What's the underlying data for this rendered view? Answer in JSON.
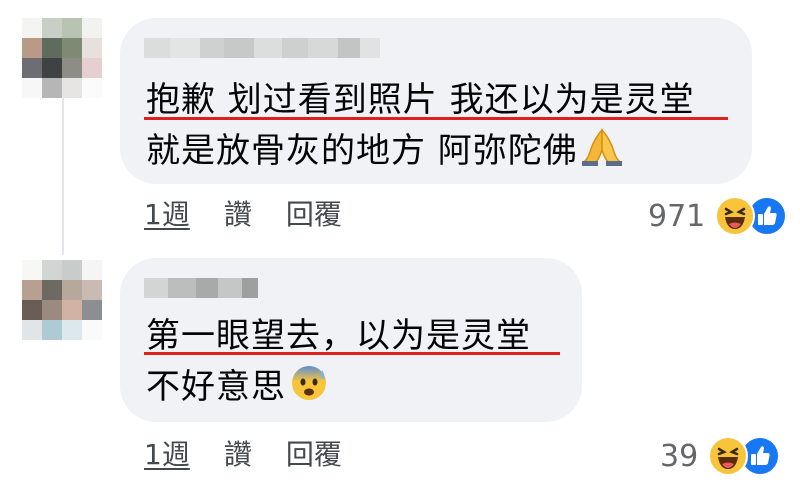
{
  "comments": [
    {
      "lines": [
        "抱歉 划过看到照片 我还以为是灵堂",
        "就是放骨灰的地方 阿弥陀佛"
      ],
      "emoji": "folded-hands-icon",
      "actions": {
        "time": "1週",
        "like": "讚",
        "reply": "回覆"
      },
      "reaction_count": "971"
    },
    {
      "lines": [
        "第一眼望去，以为是灵堂",
        "不好意思"
      ],
      "emoji": "anxious-sweat-face-icon",
      "actions": {
        "time": "1週",
        "like": "讚",
        "reply": "回覆"
      },
      "reaction_count": "39"
    }
  ],
  "colors": {
    "bubble": "#f0f2f5",
    "underline": "#e0201f",
    "like_blue": "#1877f2",
    "haha_yellow": "#f7c43c"
  }
}
